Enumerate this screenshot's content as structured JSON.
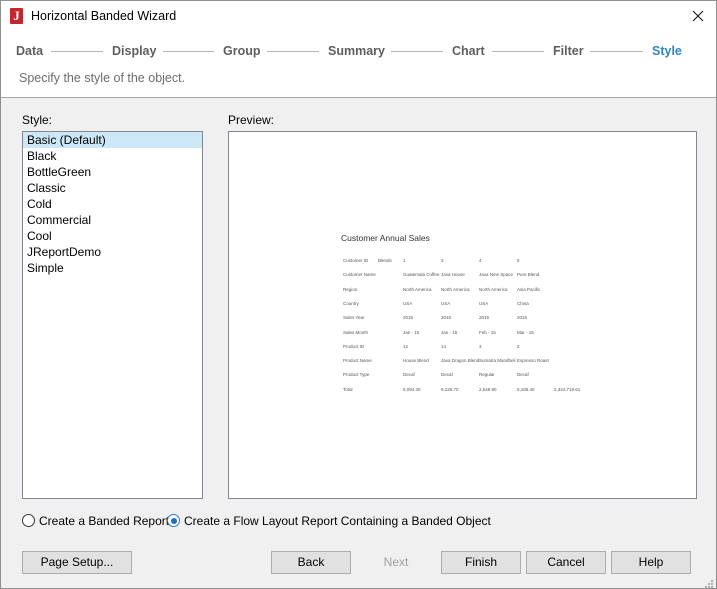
{
  "window": {
    "title": "Horizontal Banded Wizard"
  },
  "steps": [
    "Data",
    "Display",
    "Group",
    "Summary",
    "Chart",
    "Filter",
    "Style"
  ],
  "active_step": "Style",
  "subtitle": "Specify the style of the object.",
  "style_panel": {
    "label": "Style:",
    "items": [
      "Basic (Default)",
      "Black",
      "BottleGreen",
      "Classic",
      "Cold",
      "Commercial",
      "Cool",
      "JReportDemo",
      "Simple"
    ],
    "selected": "Basic (Default)"
  },
  "preview": {
    "label": "Preview:",
    "title": "Customer Annual Sales",
    "rows": [
      [
        "Customer ID",
        "Blends",
        "1",
        "3",
        "4",
        "5",
        ""
      ],
      [
        "Customer Name",
        "",
        "Guatemala Coffee",
        "Java House",
        "Java Nine Space",
        "Pure Blend",
        ""
      ],
      [
        "Region",
        "",
        "North America",
        "North America",
        "North America",
        "Asia Pacific",
        ""
      ],
      [
        "Country",
        "",
        "USA",
        "USA",
        "USA",
        "China",
        ""
      ],
      [
        "Sales Year",
        "",
        "2015",
        "2015",
        "2015",
        "2015",
        ""
      ],
      [
        "Sales Month",
        "",
        "Jan - 15",
        "Jan - 15",
        "Feb - 15",
        "Mar - 15",
        ""
      ],
      [
        "Product ID",
        "",
        "12",
        "14",
        "3",
        "2",
        ""
      ],
      [
        "Product Name",
        "",
        "House Blend",
        "Java Dragon Blend",
        "Sumatra Mandheli",
        "Espresso Roast",
        ""
      ],
      [
        "Product Type",
        "",
        "Decaf",
        "Decaf",
        "Regular",
        "Decaf",
        ""
      ],
      [
        "Total",
        "",
        "5,094.40",
        "9,226.70",
        "2,549.90",
        "5,185.40",
        "2,324,719.61"
      ]
    ]
  },
  "options": {
    "banded_report": "Create a Banded Report",
    "flow_layout": "Create a Flow Layout Report Containing a Banded Object",
    "selected": "flow_layout"
  },
  "buttons": {
    "page_setup": "Page Setup...",
    "back": "Back",
    "next": "Next",
    "finish": "Finish",
    "cancel": "Cancel",
    "help": "Help"
  }
}
